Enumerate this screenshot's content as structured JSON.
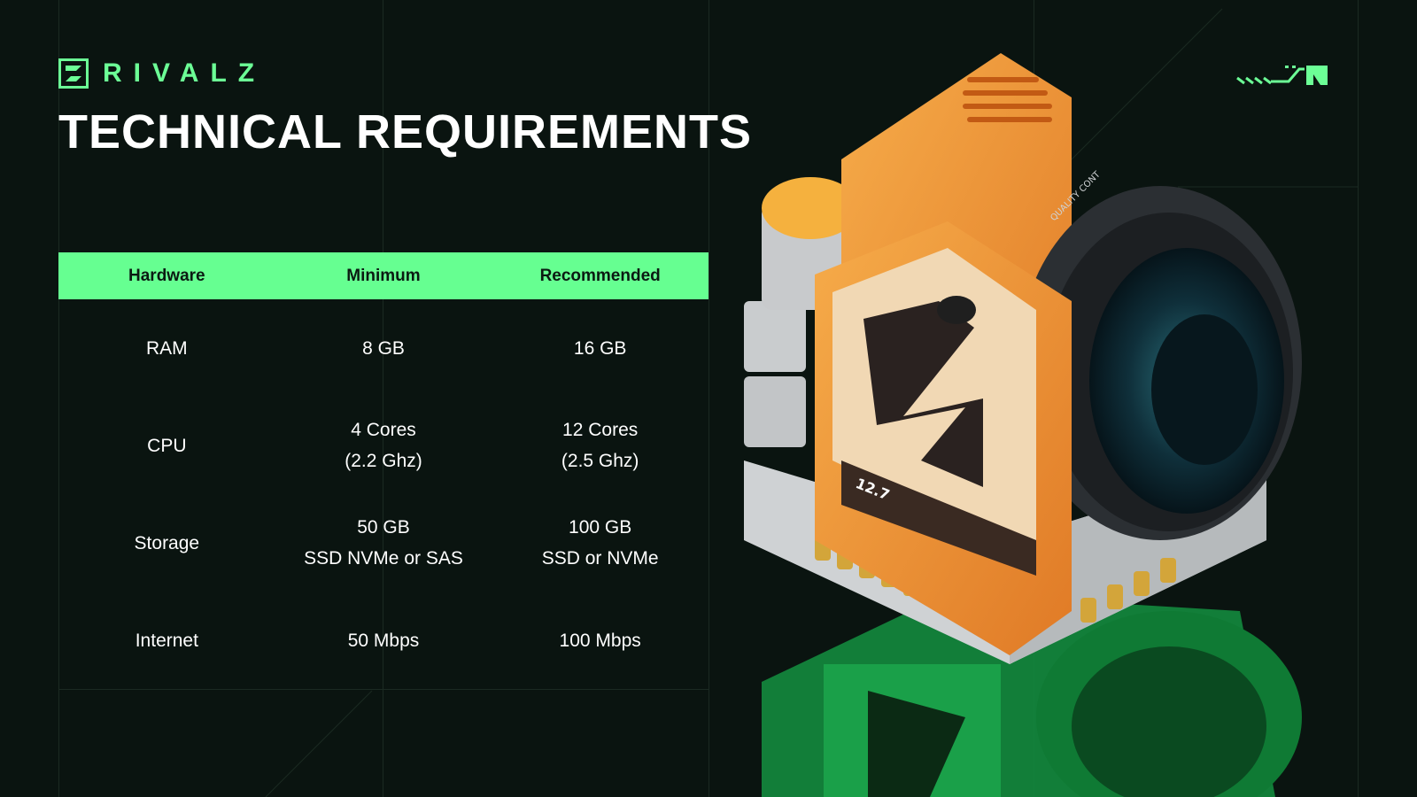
{
  "brand": {
    "name": "RIVALZ",
    "accent": "#6cff96"
  },
  "page": {
    "title": "TECHNICAL REQUIREMENTS"
  },
  "table": {
    "headers": [
      "Hardware",
      "Minimum",
      "Recommended"
    ],
    "rows": [
      {
        "hardware": "RAM",
        "minimum": [
          "8 GB"
        ],
        "recommended": [
          "16 GB"
        ]
      },
      {
        "hardware": "CPU",
        "minimum": [
          "4 Cores",
          "(2.2 Ghz)"
        ],
        "recommended": [
          "12 Cores",
          "(2.5 Ghz)"
        ]
      },
      {
        "hardware": "Storage",
        "minimum": [
          "50 GB",
          "SSD NVMe or SAS"
        ],
        "recommended": [
          "100 GB",
          "SSD or NVMe"
        ]
      },
      {
        "hardware": "Internet",
        "minimum": [
          "50 Mbps"
        ],
        "recommended": [
          "100 Mbps"
        ]
      }
    ]
  },
  "illustration": {
    "name": "camera-illustration",
    "screen_text": "12.7",
    "lens_text": "QUALITY CONT"
  },
  "icons": {
    "brand_logo": "rivalz-logo-icon",
    "partner_logo": "partner-logo-icon"
  }
}
